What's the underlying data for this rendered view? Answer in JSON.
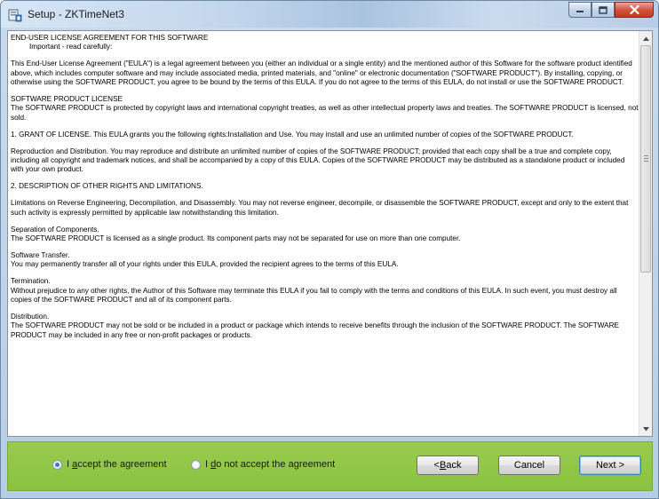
{
  "window": {
    "title": "Setup - ZKTimeNet3",
    "controls": {
      "minimize": "minimize",
      "maximize": "maximize",
      "close": "close"
    }
  },
  "license": {
    "paragraphs": [
      "END-USER LICENSE AGREEMENT FOR THIS SOFTWARE",
      "Important - read carefully:",
      "This End-User License Agreement (\"EULA\") is a legal agreement between you (either an individual or a single entity) and the mentioned author of this Software for the software product identified above, which includes computer software and may include associated media, printed materials, and \"online\" or electronic documentation (\"SOFTWARE PRODUCT\"). By installing, copying, or otherwise using the SOFTWARE PRODUCT, you agree to be bound by the terms of this EULA. If you do not agree to the terms of this EULA, do not install or use the SOFTWARE PRODUCT.",
      "SOFTWARE PRODUCT LICENSE\nThe SOFTWARE PRODUCT is protected by copyright laws and international copyright treaties, as well as other intellectual property laws and treaties. The SOFTWARE PRODUCT is licensed, not sold.",
      "1. GRANT OF LICENSE. This EULA grants you the following rights:Installation and Use. You may install and use an unlimited number of copies of the SOFTWARE PRODUCT.",
      "Reproduction and Distribution. You may reproduce and distribute an unlimited number of copies of the SOFTWARE PRODUCT; provided that each copy shall be a true and complete copy, including all copyright and trademark notices, and shall be accompanied by a copy of this EULA. Copies of the SOFTWARE PRODUCT may be distributed as a standalone product or included with your own product.",
      "2. DESCRIPTION OF OTHER RIGHTS AND LIMITATIONS.",
      "Limitations on Reverse Engineering, Decompilation, and Disassembly. You may not reverse engineer, decompile, or disassemble the SOFTWARE PRODUCT, except and only to the extent that such activity is expressly permitted by applicable law notwithstanding this limitation.",
      "Separation of Components.\nThe SOFTWARE PRODUCT is licensed as a single product. Its component parts may not be separated for use on more than one computer.",
      "Software Transfer.\nYou may permanently transfer all of your rights under this EULA, provided the recipient agrees to the terms of this EULA.",
      "Termination.\nWithout prejudice to any other rights, the Author of this Software may terminate this EULA if you fail to comply with the terms and conditions of this EULA. In such event, you must destroy all copies of the SOFTWARE PRODUCT and all of its component parts.",
      "Distribution.\nThe SOFTWARE PRODUCT may not be sold or be included in a product or package which intends to receive benefits through the inclusion of the SOFTWARE PRODUCT. The SOFTWARE PRODUCT may be included in any free or non-profit packages or products."
    ]
  },
  "footer": {
    "accept": {
      "prefix": "I ",
      "key": "a",
      "suffix": "ccept the agreement",
      "selected": true
    },
    "decline": {
      "prefix": "I ",
      "key": "d",
      "suffix": "o not accept the agreement",
      "selected": false
    },
    "back": {
      "prefix": "< ",
      "key": "B",
      "suffix": "ack"
    },
    "cancel": "Cancel",
    "next": "Next >"
  },
  "colors": {
    "footer": "#8ac23f",
    "title_bar": "#c2d6ec",
    "close_button": "#c4391f",
    "radio_selected": "#3c79c6"
  }
}
